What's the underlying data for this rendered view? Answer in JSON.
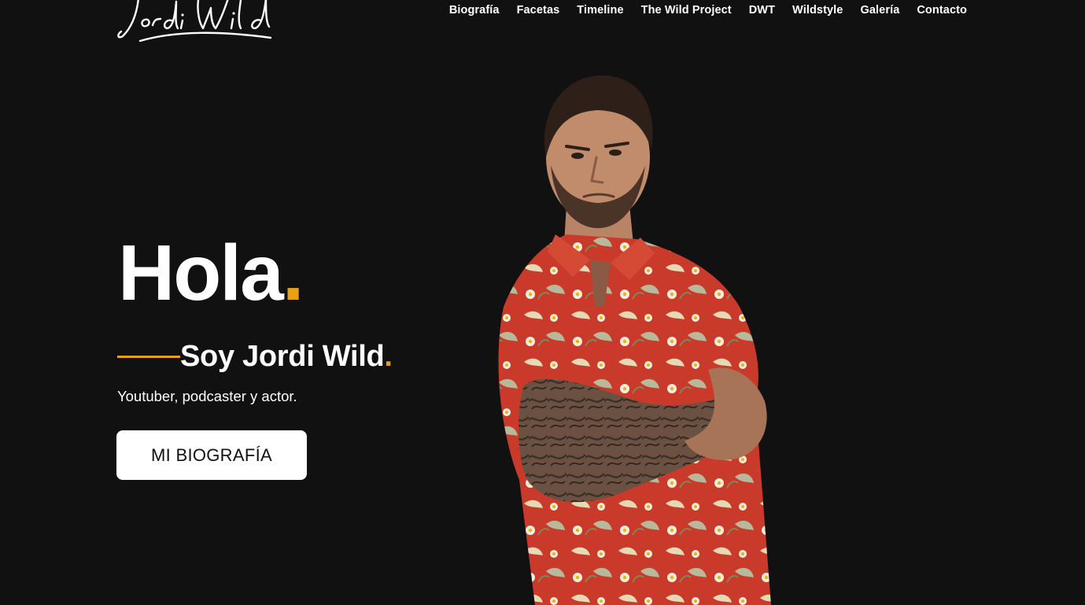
{
  "logo": {
    "text": "Jordi Wild"
  },
  "nav": {
    "items": [
      {
        "label": "Biografía"
      },
      {
        "label": "Facetas"
      },
      {
        "label": "Timeline"
      },
      {
        "label": "The Wild Project"
      },
      {
        "label": "DWT"
      },
      {
        "label": "Wildstyle"
      },
      {
        "label": "Galería"
      },
      {
        "label": "Contacto"
      }
    ]
  },
  "hero": {
    "title": "Hola",
    "title_dot": ".",
    "subtitle": "Soy Jordi Wild",
    "subtitle_dot": ".",
    "tagline": "Youtuber, podcaster y actor.",
    "cta_label": "MI BIOGRAFÍA"
  },
  "colors": {
    "background": "#111111",
    "accent": "#e6a117",
    "text": "#ffffff",
    "button_bg": "#ffffff",
    "button_text": "#111111"
  }
}
